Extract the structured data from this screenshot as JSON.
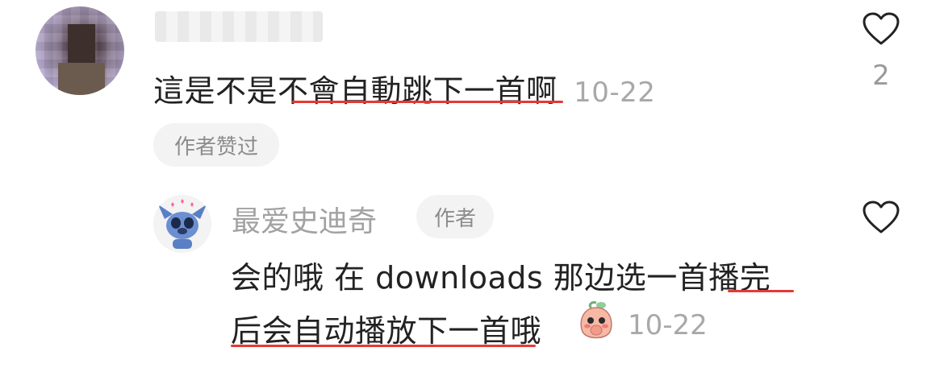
{
  "comment": {
    "avatar_icon": "blurred-user-avatar",
    "text_before": "這是不是",
    "text_underlined": "不會自動跳下一首",
    "text_after": "啊",
    "time": "10-22",
    "liked_badge": "作者赞过",
    "like_count": "2",
    "underline_color": "#e53935"
  },
  "reply": {
    "author_name": "最爱史迪奇",
    "author_badge": "作者",
    "line1_plain": "会的哦 在 downloads 那边选一首",
    "line1_underlined": "播完",
    "line2_underlined": "后会自动播放下一首",
    "line2_after": "哦",
    "emoji": "peach-shy-emoji",
    "time": "10-22"
  }
}
